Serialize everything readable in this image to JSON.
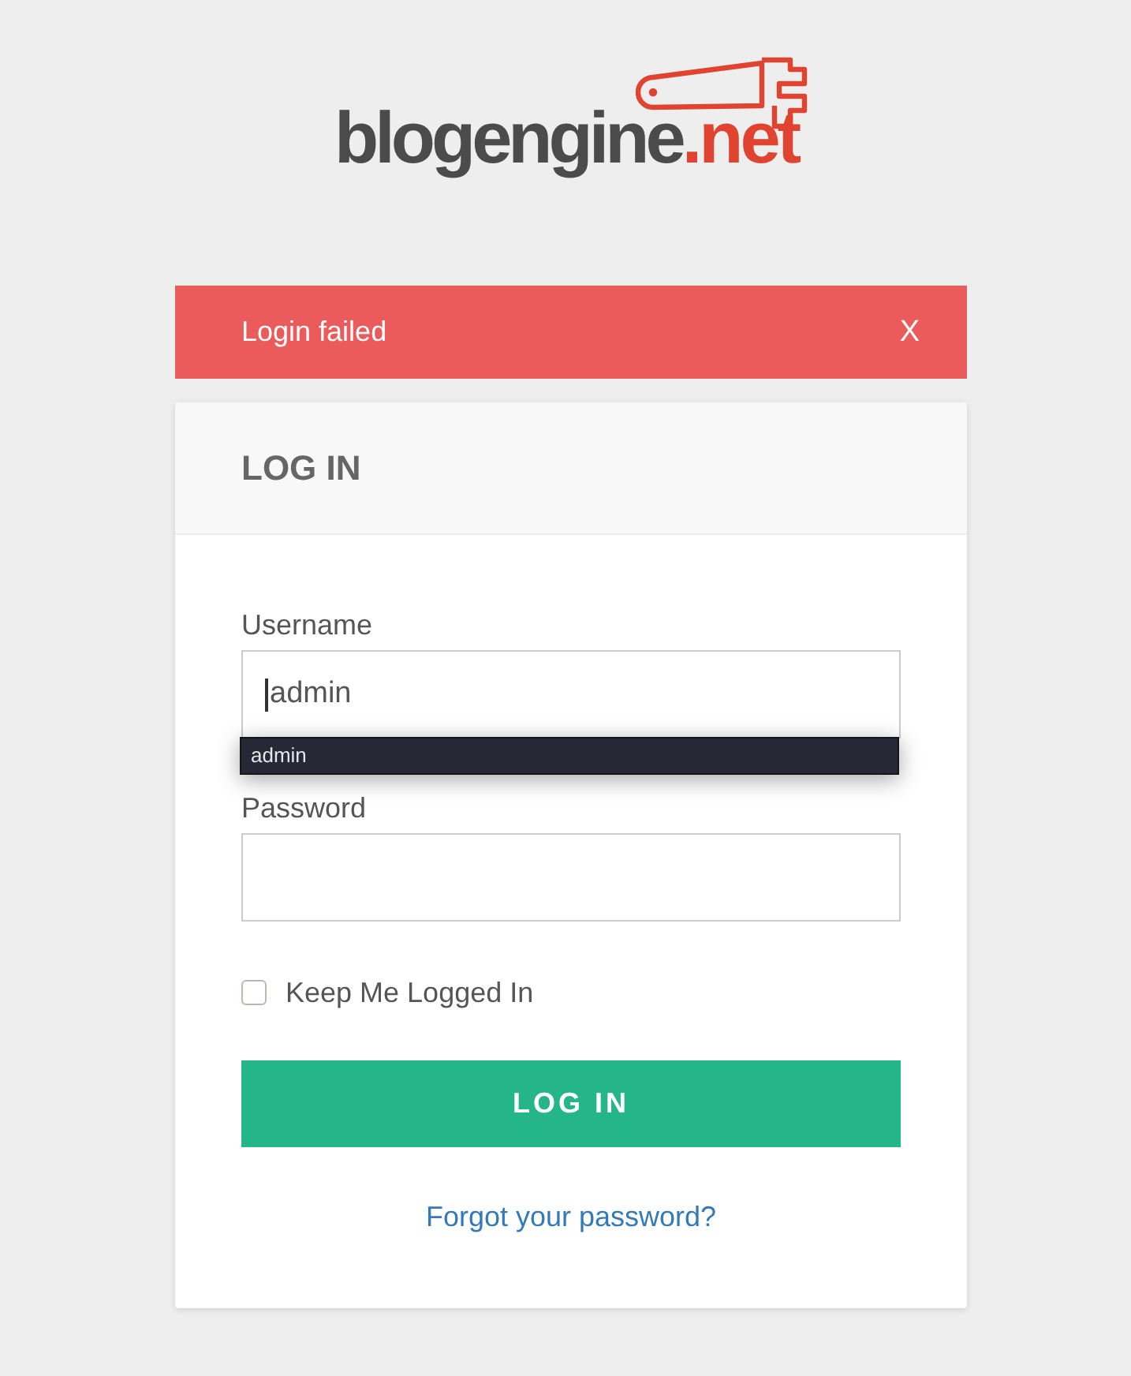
{
  "logo": {
    "name": "blogengine",
    "suffix": ".net"
  },
  "alert": {
    "message": "Login failed",
    "close": "X"
  },
  "card": {
    "title": "LOG IN"
  },
  "fields": [
    {
      "label": "Username",
      "value": "admin",
      "focused": true,
      "suggestions": [
        "admin"
      ]
    },
    {
      "label": "Password",
      "focused": false
    }
  ],
  "remember": {
    "label": "Keep Me Logged In",
    "checked": false
  },
  "submit": {
    "label": "LOG IN"
  },
  "forgot_link": {
    "label": "Forgot your password?"
  }
}
